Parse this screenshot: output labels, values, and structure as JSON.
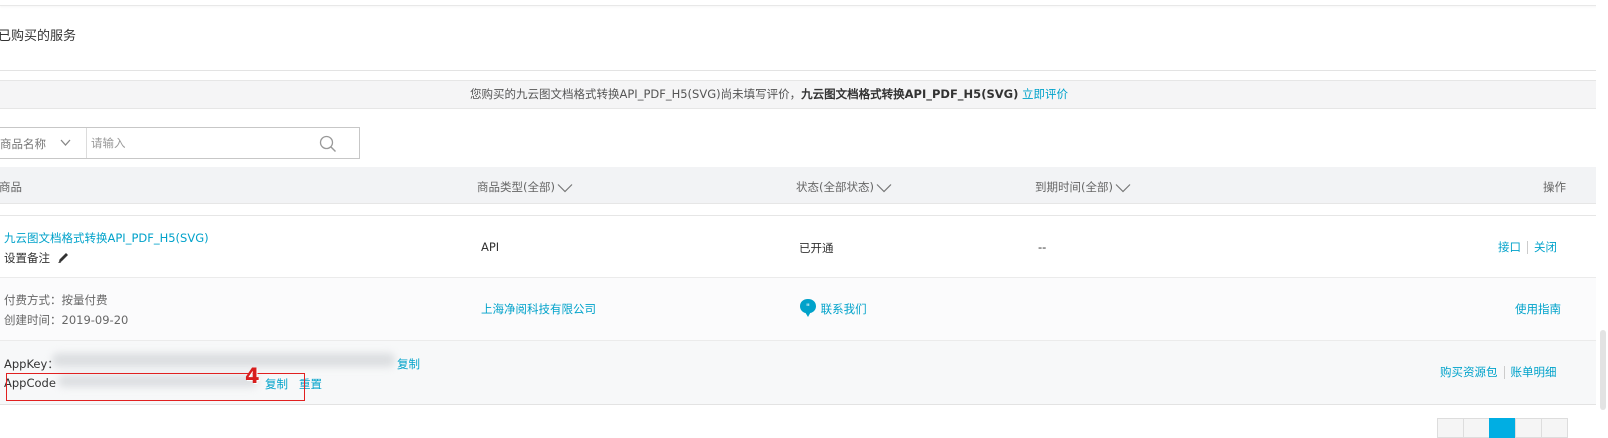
{
  "page_title": "已购买的服务",
  "notice": {
    "prefix": "您购买的九云图文档格式转换API_PDF_H5(SVG)尚未填写评价，",
    "product": "九云图文档格式转换API_PDF_H5(SVG)",
    "action": "立即评价"
  },
  "search": {
    "select_value": "商品名称",
    "placeholder": "请输入"
  },
  "table_header": {
    "product": "商品",
    "type": "商品类型(全部)",
    "status": "状态(全部状态)",
    "expiry": "到期时间(全部)",
    "actions": "操作"
  },
  "row": {
    "product_name": "九云图文档格式转换API_PDF_H5(SVG)",
    "remark": "设置备注",
    "type": "API",
    "status": "已开通",
    "expiry": "--",
    "action_api": "接口",
    "action_close": "关闭",
    "billing": "付费方式：按量付费",
    "created": "创建时间：2019-09-20",
    "vendor": "上海净阅科技有限公司",
    "contact": "联系我们",
    "guide": "使用指南",
    "appkey_label": "AppKey：",
    "appkey_copy": "复制",
    "appcode_label": "AppCode",
    "appcode_copy": "复制",
    "appcode_reset": "重置",
    "buy_package": "购买资源包",
    "bill_detail": "账单明细"
  },
  "annotation": {
    "step": "4"
  },
  "colors": {
    "link": "#00a2ca",
    "annotation_red": "#e12020",
    "pager_active": "#00aee3"
  }
}
